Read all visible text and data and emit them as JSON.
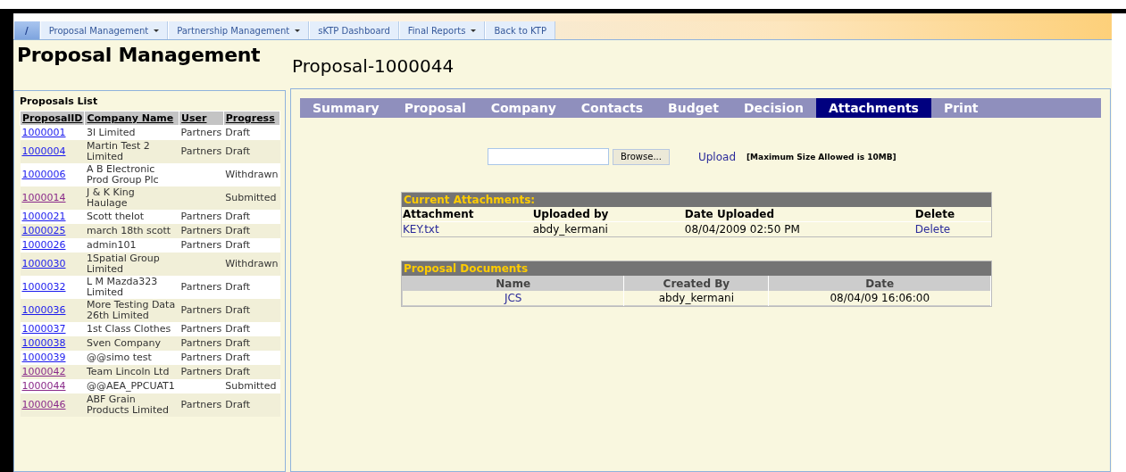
{
  "nav": [
    {
      "label": "/",
      "selected": true,
      "dropdown": false
    },
    {
      "label": "Proposal Management",
      "selected": false,
      "dropdown": true
    },
    {
      "label": "Partnership Management",
      "selected": false,
      "dropdown": true
    },
    {
      "label": "sKTP Dashboard",
      "selected": false,
      "dropdown": false
    },
    {
      "label": "Final Reports",
      "selected": false,
      "dropdown": true
    },
    {
      "label": "Back to KTP",
      "selected": false,
      "dropdown": false
    }
  ],
  "sidebar": {
    "title": "Proposal Management",
    "list_title": "Proposals List",
    "columns": [
      "ProposalID",
      "Company Name",
      "User",
      "Progress"
    ],
    "rows": [
      {
        "id": "1000001",
        "company": "3l Limited",
        "user": "Partners",
        "progress": "Draft",
        "visited": false
      },
      {
        "id": "1000004",
        "company": "Martin Test 2 Limited",
        "user": "Partners",
        "progress": "Draft",
        "visited": false
      },
      {
        "id": "1000006",
        "company": "A B Electronic Prod Group Plc",
        "user": "",
        "progress": "Withdrawn",
        "visited": false
      },
      {
        "id": "1000014",
        "company": "J & K King Haulage",
        "user": "",
        "progress": "Submitted",
        "visited": true
      },
      {
        "id": "1000021",
        "company": "Scott thelot",
        "user": "Partners",
        "progress": "Draft",
        "visited": false
      },
      {
        "id": "1000025",
        "company": "march 18th scott",
        "user": "Partners",
        "progress": "Draft",
        "visited": false
      },
      {
        "id": "1000026",
        "company": "admin101",
        "user": "Partners",
        "progress": "Draft",
        "visited": false
      },
      {
        "id": "1000030",
        "company": "1Spatial Group Limited",
        "user": "",
        "progress": "Withdrawn",
        "visited": false
      },
      {
        "id": "1000032",
        "company": "L M Mazda323 Limited",
        "user": "Partners",
        "progress": "Draft",
        "visited": false
      },
      {
        "id": "1000036",
        "company": "More Testing Data 26th Limited",
        "user": "Partners",
        "progress": "Draft",
        "visited": false
      },
      {
        "id": "1000037",
        "company": "1st Class Clothes",
        "user": "Partners",
        "progress": "Draft",
        "visited": false
      },
      {
        "id": "1000038",
        "company": "Sven Company",
        "user": "Partners",
        "progress": "Draft",
        "visited": false
      },
      {
        "id": "1000039",
        "company": "@@simo test",
        "user": "Partners",
        "progress": "Draft",
        "visited": false
      },
      {
        "id": "1000042",
        "company": "Team Lincoln Ltd",
        "user": "Partners",
        "progress": "Draft",
        "visited": true
      },
      {
        "id": "1000044",
        "company": "@@AEA_PPCUAT1",
        "user": "",
        "progress": "Submitted",
        "visited": true
      },
      {
        "id": "1000046",
        "company": "ABF Grain Products Limited",
        "user": "Partners",
        "progress": "Draft",
        "visited": true
      }
    ]
  },
  "main": {
    "title": "Proposal-1000044",
    "tabs": [
      {
        "label": "Summary",
        "selected": false
      },
      {
        "label": "Proposal",
        "selected": false
      },
      {
        "label": "Company",
        "selected": false
      },
      {
        "label": "Contacts",
        "selected": false
      },
      {
        "label": "Budget",
        "selected": false
      },
      {
        "label": "Decision",
        "selected": false
      },
      {
        "label": "Attachments",
        "selected": true
      },
      {
        "label": "Print",
        "selected": false
      }
    ],
    "upload": {
      "browse": "Browse...",
      "upload": "Upload",
      "note": "[Maximum Size Allowed is 10MB]"
    },
    "attachments": {
      "title": "Current Attachments:",
      "columns": [
        "Attachment",
        "Uploaded by",
        "Date Uploaded",
        "Delete"
      ],
      "rows": [
        {
          "file": "KEY.txt",
          "by": "abdy_kermani",
          "date": "08/04/2009 02:50 PM",
          "action": "Delete"
        }
      ]
    },
    "documents": {
      "title": "Proposal Documents",
      "columns": [
        "Name",
        "Created By",
        "Date"
      ],
      "rows": [
        {
          "name": "JCS",
          "by": "abdy_kermani",
          "date": "08/04/09 16:06:00"
        }
      ]
    }
  }
}
